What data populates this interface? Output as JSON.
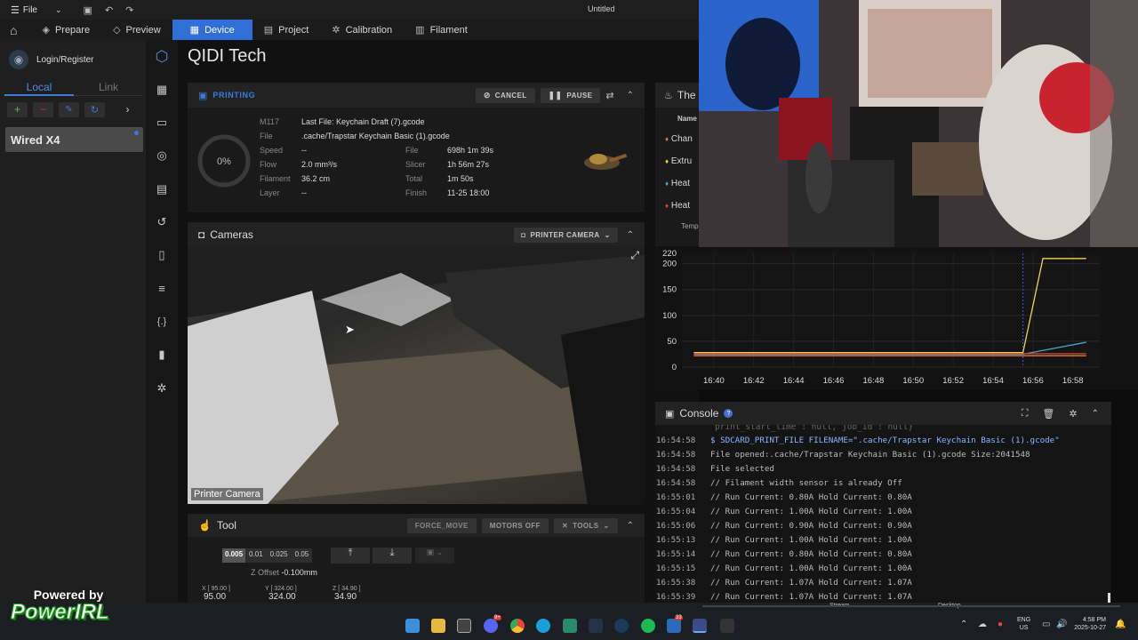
{
  "titlebar": {
    "file_label": "File",
    "doc_title": "Untitled"
  },
  "tabs": [
    {
      "label": "Prepare"
    },
    {
      "label": "Preview"
    },
    {
      "label": "Device"
    },
    {
      "label": "Project"
    },
    {
      "label": "Calibration"
    },
    {
      "label": "Filament"
    }
  ],
  "left": {
    "login_label": "Login/Register",
    "tab_local": "Local",
    "tab_link": "Link",
    "printer_name": "Wired X4"
  },
  "brand": "QIDI Tech",
  "printing": {
    "title": "PRINTING",
    "cancel_label": "CANCEL",
    "pause_label": "PAUSE",
    "progress_label": "0%",
    "progress": 0,
    "rows_left": [
      {
        "key": "M117",
        "value": "Last File: Keychain Draft (7).gcode"
      },
      {
        "key": "File",
        "value": ".cache/Trapstar Keychain Basic (1).gcode"
      },
      {
        "key": "Speed",
        "value": "--"
      },
      {
        "key": "Flow",
        "value": "2.0 mm³/s"
      },
      {
        "key": "Filament",
        "value": "36.2 cm"
      },
      {
        "key": "Layer",
        "value": "--"
      }
    ],
    "rows_right": [
      {
        "key": "File",
        "value": "698h 1m 39s"
      },
      {
        "key": "Slicer",
        "value": "1h 56m 27s"
      },
      {
        "key": "Total",
        "value": "1m 50s"
      },
      {
        "key": "Finish",
        "value": "11-25 18:00"
      }
    ]
  },
  "cameras": {
    "title": "Cameras",
    "selector_label": "PRINTER CAMERA",
    "feed_caption": "Printer Camera"
  },
  "tool": {
    "title": "Tool",
    "force_move_label": "FORCE_MOVE",
    "motors_off_label": "MOTORS OFF",
    "tools_label": "TOOLS",
    "steps": [
      "0.005",
      "0.01",
      "0.025",
      "0.05"
    ],
    "zoffset_label": "Z Offset",
    "zoffset_value": "-0.100mm",
    "x_label": "X [ 95.00 ]",
    "x_value": "95.00",
    "y_label": "Y [ 324.00 ]",
    "y_value": "324.00",
    "z_label": "Z [ 34.90 ]",
    "z_value": "34.90"
  },
  "thermals": {
    "title": "The",
    "col_name": "Name",
    "rows": [
      "Chan",
      "Extru",
      "Heat",
      "Heat"
    ],
    "temp_label": "Temp"
  },
  "chart_data": {
    "type": "line",
    "x_ticks": [
      "16:40",
      "16:42",
      "16:44",
      "16:46",
      "16:48",
      "16:50",
      "16:52",
      "16:54",
      "16:56",
      "16:58"
    ],
    "y_ticks": [
      0,
      50,
      100,
      150,
      200,
      220
    ],
    "ylim": [
      0,
      220
    ],
    "series": [
      {
        "color": "#f2d14a",
        "x": [
          "16:39",
          "16:55:30",
          "16:56:30",
          "16:58:40"
        ],
        "values": [
          28,
          28,
          210,
          210
        ]
      },
      {
        "color": "#3fa9c9",
        "x": [
          "16:39",
          "16:55:30",
          "16:58:40"
        ],
        "values": [
          25,
          25,
          48
        ]
      },
      {
        "color": "#e0413a",
        "x": [
          "16:39",
          "16:58:40"
        ],
        "values": [
          26,
          26
        ]
      },
      {
        "color": "#e07a3a",
        "x": [
          "16:39",
          "16:58:40"
        ],
        "values": [
          22,
          22
        ]
      }
    ],
    "grid": true
  },
  "console": {
    "title": "Console",
    "partial_line": "print_start_time : null, job_id : null}",
    "lines": [
      {
        "time": "16:54:58",
        "text": "$ SDCARD_PRINT_FILE FILENAME=\".cache/Trapstar Keychain Basic (1).gcode\"",
        "cmd": true
      },
      {
        "time": "16:54:58",
        "text": "File opened:.cache/Trapstar Keychain Basic (1).gcode Size:2041548"
      },
      {
        "time": "16:54:58",
        "text": "File selected"
      },
      {
        "time": "16:54:58",
        "text": "// Filament width sensor is already Off"
      },
      {
        "time": "16:55:01",
        "text": "// Run Current: 0.80A Hold Current: 0.80A"
      },
      {
        "time": "16:55:04",
        "text": "// Run Current: 1.00A Hold Current: 1.00A"
      },
      {
        "time": "16:55:06",
        "text": "// Run Current: 0.90A Hold Current: 0.90A"
      },
      {
        "time": "16:55:13",
        "text": "// Run Current: 1.00A Hold Current: 1.00A"
      },
      {
        "time": "16:55:14",
        "text": "// Run Current: 0.80A Hold Current: 0.80A"
      },
      {
        "time": "16:55:15",
        "text": "// Run Current: 1.00A Hold Current: 1.00A"
      },
      {
        "time": "16:55:38",
        "text": "// Run Current: 1.07A Hold Current: 1.07A"
      },
      {
        "time": "16:55:39",
        "text": "// Run Current: 1.07A Hold Current: 1.07A"
      }
    ]
  },
  "overlay": {
    "powered_by": "Powered by",
    "brand": "PowerIRL",
    "stream_label": "Stream",
    "desktop_label": "Desktop"
  },
  "taskbar": {
    "lang_top": "ENG",
    "lang_bottom": "US",
    "time": "4:58 PM",
    "date": "2025-10-27",
    "badge_discord": "9+",
    "badge_other": "33"
  }
}
